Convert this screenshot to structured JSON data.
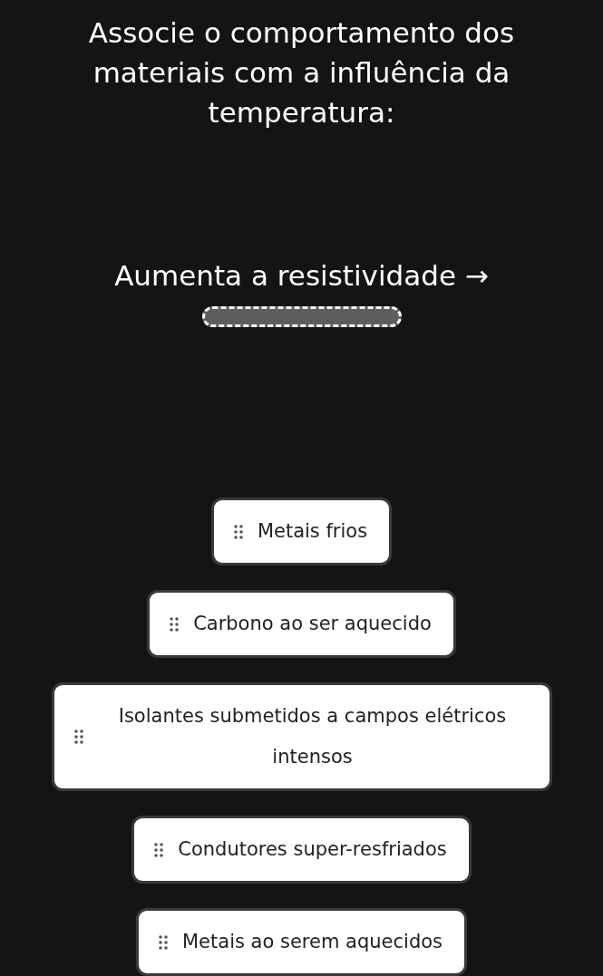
{
  "question": {
    "title": "Associe o comportamento dos materiais com a influência da temperatura:"
  },
  "prompt": {
    "text": "Aumenta a resistividade →"
  },
  "options": [
    {
      "label": "Metais frios"
    },
    {
      "label": "Carbono ao ser aquecido"
    },
    {
      "label": "Isolantes submetidos a campos elétricos intensos"
    },
    {
      "label": "Condutores super-resfriados"
    },
    {
      "label": "Metais ao serem aquecidos"
    }
  ]
}
